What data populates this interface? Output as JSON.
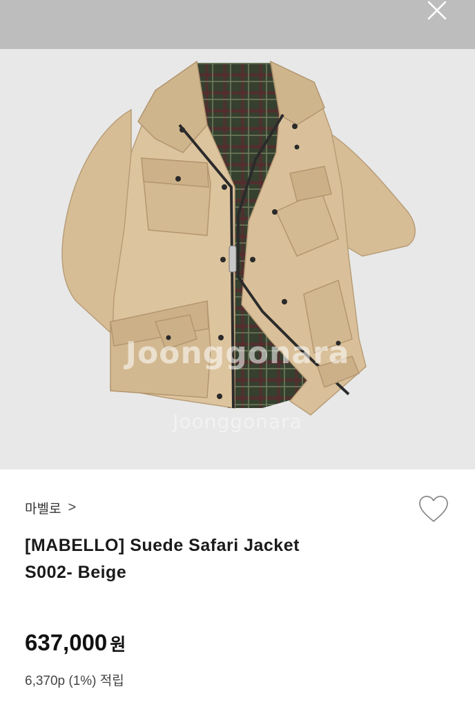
{
  "header": {
    "close_icon": "close-icon"
  },
  "product": {
    "image_alt": "jacket-photo",
    "watermark": "Joonggonara",
    "brand": "마벨로",
    "brand_chevron": ">",
    "title_line1": "[MABELLO] Suede Safari Jacket",
    "title_line2": "S002- Beige",
    "price": "637,000",
    "currency": "원",
    "points": "6,370p (1%) 적립",
    "wishlist_icon": "heart-icon"
  },
  "colors": {
    "top_bar": "#bdbdbd",
    "photo_bg": "#e8e8e8",
    "jacket": "#d8bf98",
    "lining": "#3f4a38"
  }
}
